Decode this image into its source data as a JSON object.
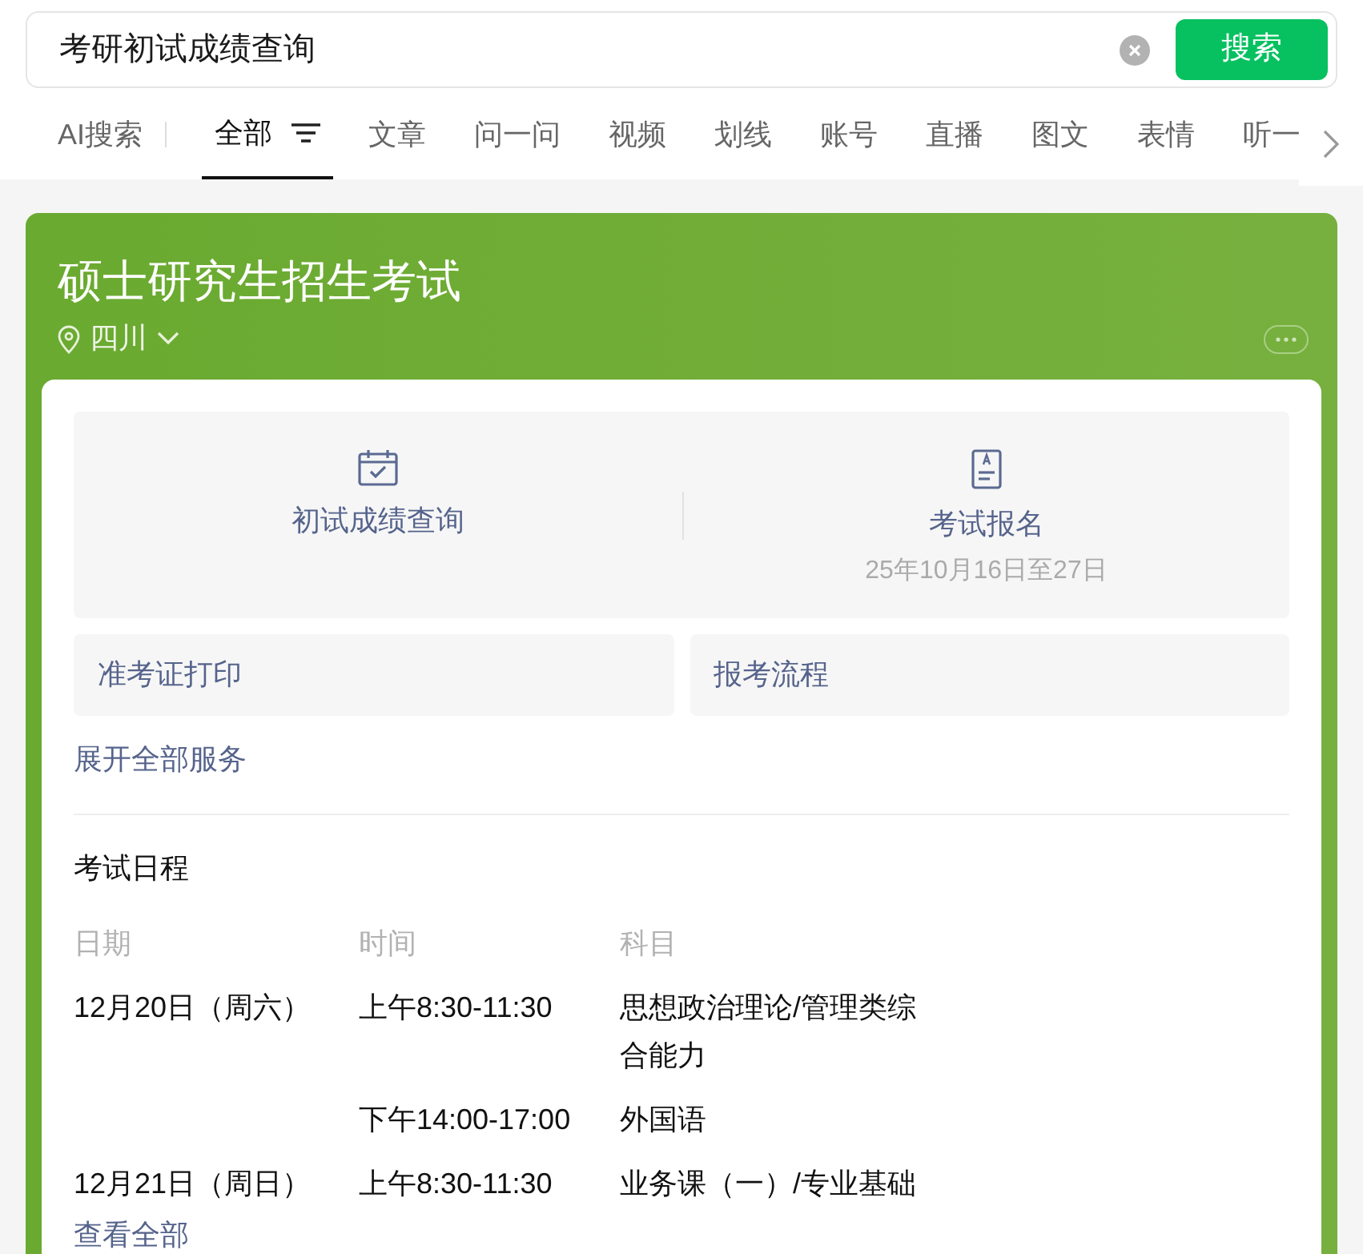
{
  "search": {
    "value": "考研初试成绩查询",
    "button": "搜索"
  },
  "tabs": [
    {
      "label": "AI搜索",
      "selected": false,
      "kind": "ai"
    },
    {
      "label": "全部",
      "selected": true,
      "kind": "filter"
    },
    {
      "label": "文章",
      "selected": false,
      "kind": "plain"
    },
    {
      "label": "问一问",
      "selected": false,
      "kind": "plain"
    },
    {
      "label": "视频",
      "selected": false,
      "kind": "plain"
    },
    {
      "label": "划线",
      "selected": false,
      "kind": "plain"
    },
    {
      "label": "账号",
      "selected": false,
      "kind": "plain"
    },
    {
      "label": "直播",
      "selected": false,
      "kind": "plain"
    },
    {
      "label": "图文",
      "selected": false,
      "kind": "plain"
    },
    {
      "label": "表情",
      "selected": false,
      "kind": "plain"
    },
    {
      "label": "听一",
      "selected": false,
      "kind": "plain"
    }
  ],
  "card": {
    "title": "硕士研究生招生考试",
    "location": "四川",
    "services": [
      {
        "label": "初试成绩查询",
        "kind": "calendar"
      },
      {
        "label": "考试报名",
        "kind": "document",
        "note": "25年10月16日至27日"
      }
    ],
    "links": [
      "准考证打印",
      "报考流程"
    ],
    "expand": "展开全部服务",
    "schedule": {
      "title": "考试日程",
      "columns": [
        "日期",
        "时间",
        "科目"
      ],
      "rows": [
        {
          "date": "12月20日（周六）",
          "time": "上午8:30-11:30",
          "subject": "思想政治理论/管理类综合能力"
        },
        {
          "time": "下午14:00-17:00",
          "subject": "外国语"
        },
        {
          "date": "12月21日（周日）",
          "time": "上午8:30-11:30",
          "subject": "业务课（一）/专业基础"
        }
      ]
    },
    "view_all": "查看全部"
  }
}
